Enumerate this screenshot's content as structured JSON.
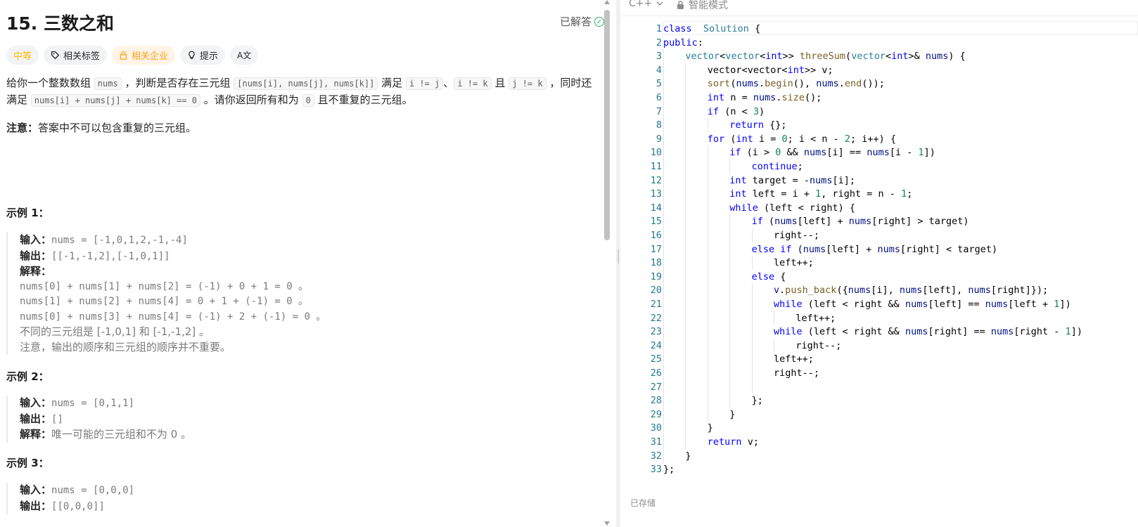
{
  "problem": {
    "title": "15. 三数之和",
    "status_label": "已解答",
    "tags": {
      "difficulty": "中等",
      "related_tags": "相关标签",
      "related_companies": "相关企业",
      "hint": "提示",
      "translate": "A文"
    },
    "desc": {
      "p1_a": "给你一个整数数组",
      "c_nums": "nums",
      "p1_b": "，判断是否存在三元组",
      "c_triple": "[nums[i], nums[j], nums[k]]",
      "p1_c": "满足",
      "c_ij": "i != j",
      "sep1": "、",
      "c_ik": "i != k",
      "p1_d": "且",
      "c_jk": "j != k",
      "p1_e": "，同时还满足",
      "c_sum": "nums[i] + nums[j] + nums[k] == 0",
      "p1_f": "。请你返回所有和为",
      "c_zero": "0",
      "p1_g": "且不重复的三元组。"
    },
    "note_label": "注意：",
    "note_text": "答案中不可以包含重复的三元组。",
    "examples": {
      "e1_title": "示例 1：",
      "e1_input_label": "输入：",
      "e1_input": "nums = [-1,0,1,2,-1,-4]",
      "e1_output_label": "输出：",
      "e1_output": "[[-1,-1,2],[-1,0,1]]",
      "e1_expl_label": "解释：",
      "e1_l1": "nums[0] + nums[1] + nums[2] = (-1) + 0 + 1 = 0 。",
      "e1_l2": "nums[1] + nums[2] + nums[4] = 0 + 1 + (-1) = 0 。",
      "e1_l3": "nums[0] + nums[3] + nums[4] = (-1) + 2 + (-1) = 0 。",
      "e1_l4": "不同的三元组是 [-1,0,1] 和 [-1,-1,2] 。",
      "e1_l5": "注意，输出的顺序和三元组的顺序并不重要。",
      "e2_title": "示例 2：",
      "e2_input_label": "输入：",
      "e2_input": "nums = [0,1,1]",
      "e2_output_label": "输出：",
      "e2_output": "[]",
      "e2_expl_label": "解释：",
      "e2_expl": "唯一可能的三元组和不为 0 。",
      "e3_title": "示例 3：",
      "e3_input_label": "输入：",
      "e3_input": "nums = [0,0,0]",
      "e3_output_label": "输出：",
      "e3_output": "[[0,0,0]]"
    }
  },
  "editor": {
    "language": "C++",
    "mode": "智能模式",
    "saved_label": "已存储",
    "lines": [
      {
        "n": "1",
        "indent": 0,
        "code": [
          [
            "kw",
            "class"
          ],
          [
            "",
            "  "
          ],
          [
            "ty",
            "Solution"
          ],
          [
            "",
            " {"
          ]
        ]
      },
      {
        "n": "2",
        "indent": 0,
        "code": [
          [
            "kw",
            "public"
          ],
          [
            "",
            ":"
          ]
        ]
      },
      {
        "n": "3",
        "indent": 1,
        "code": [
          [
            "ty",
            "vector"
          ],
          [
            "",
            "<"
          ],
          [
            "ty",
            "vector"
          ],
          [
            "",
            "<"
          ],
          [
            "kw",
            "int"
          ],
          [
            "",
            ">> "
          ],
          [
            "fn",
            "threeSum"
          ],
          [
            "",
            "("
          ],
          [
            "ty",
            "vector"
          ],
          [
            "",
            "<"
          ],
          [
            "kw",
            "int"
          ],
          [
            "",
            ">& "
          ],
          [
            "vr",
            "nums"
          ],
          [
            "",
            ") {"
          ]
        ]
      },
      {
        "n": "4",
        "indent": 2,
        "code": [
          [
            "",
            "vector<vector<"
          ],
          [
            "kw",
            "int"
          ],
          [
            "",
            ">> v;"
          ]
        ]
      },
      {
        "n": "5",
        "indent": 2,
        "code": [
          [
            "fn",
            "sort"
          ],
          [
            "",
            "("
          ],
          [
            "vr",
            "nums"
          ],
          [
            "",
            "."
          ],
          [
            "fn",
            "begin"
          ],
          [
            "",
            "(), "
          ],
          [
            "vr",
            "nums"
          ],
          [
            "",
            "."
          ],
          [
            "fn",
            "end"
          ],
          [
            "",
            "());"
          ]
        ]
      },
      {
        "n": "6",
        "indent": 2,
        "code": [
          [
            "kw",
            "int"
          ],
          [
            "",
            " n = "
          ],
          [
            "vr",
            "nums"
          ],
          [
            "",
            "."
          ],
          [
            "fn",
            "size"
          ],
          [
            "",
            "();"
          ]
        ]
      },
      {
        "n": "7",
        "indent": 2,
        "code": [
          [
            "kw",
            "if"
          ],
          [
            "",
            " (n < "
          ],
          [
            "nm",
            "3"
          ],
          [
            "",
            ")"
          ]
        ]
      },
      {
        "n": "8",
        "indent": 3,
        "code": [
          [
            "kw",
            "return"
          ],
          [
            "",
            " {};"
          ]
        ]
      },
      {
        "n": "9",
        "indent": 2,
        "code": [
          [
            "kw",
            "for"
          ],
          [
            "",
            " ("
          ],
          [
            "kw",
            "int"
          ],
          [
            "",
            " i = "
          ],
          [
            "nm",
            "0"
          ],
          [
            "",
            "; i < n - "
          ],
          [
            "nm",
            "2"
          ],
          [
            "",
            "; i++) {"
          ]
        ]
      },
      {
        "n": "10",
        "indent": 3,
        "code": [
          [
            "kw",
            "if"
          ],
          [
            "",
            " (i > "
          ],
          [
            "nm",
            "0"
          ],
          [
            "",
            " && "
          ],
          [
            "vr",
            "nums"
          ],
          [
            "",
            "[i] == "
          ],
          [
            "vr",
            "nums"
          ],
          [
            "",
            "[i - "
          ],
          [
            "nm",
            "1"
          ],
          [
            "",
            "])"
          ]
        ]
      },
      {
        "n": "11",
        "indent": 4,
        "code": [
          [
            "kw",
            "continue"
          ],
          [
            "",
            ";"
          ]
        ]
      },
      {
        "n": "12",
        "indent": 3,
        "code": [
          [
            "kw",
            "int"
          ],
          [
            "",
            " target = -"
          ],
          [
            "vr",
            "nums"
          ],
          [
            "",
            "[i];"
          ]
        ]
      },
      {
        "n": "13",
        "indent": 3,
        "code": [
          [
            "kw",
            "int"
          ],
          [
            "",
            " left = i + "
          ],
          [
            "nm",
            "1"
          ],
          [
            "",
            ", right = n - "
          ],
          [
            "nm",
            "1"
          ],
          [
            "",
            ";"
          ]
        ]
      },
      {
        "n": "14",
        "indent": 3,
        "code": [
          [
            "kw",
            "while"
          ],
          [
            "",
            " (left < right) {"
          ]
        ]
      },
      {
        "n": "15",
        "indent": 4,
        "code": [
          [
            "kw",
            "if"
          ],
          [
            "",
            " ("
          ],
          [
            "vr",
            "nums"
          ],
          [
            "",
            "[left] + "
          ],
          [
            "vr",
            "nums"
          ],
          [
            "",
            "[right] > target)"
          ]
        ]
      },
      {
        "n": "16",
        "indent": 5,
        "code": [
          [
            "",
            "right--;"
          ]
        ]
      },
      {
        "n": "17",
        "indent": 4,
        "code": [
          [
            "kw",
            "else"
          ],
          [
            "",
            " "
          ],
          [
            "kw",
            "if"
          ],
          [
            "",
            " ("
          ],
          [
            "vr",
            "nums"
          ],
          [
            "",
            "[left] + "
          ],
          [
            "vr",
            "nums"
          ],
          [
            "",
            "[right] < target)"
          ]
        ]
      },
      {
        "n": "18",
        "indent": 5,
        "code": [
          [
            "",
            "left++;"
          ]
        ]
      },
      {
        "n": "19",
        "indent": 4,
        "code": [
          [
            "kw",
            "else"
          ],
          [
            "",
            " {"
          ]
        ]
      },
      {
        "n": "20",
        "indent": 5,
        "code": [
          [
            "vr",
            "v"
          ],
          [
            "",
            "."
          ],
          [
            "fn",
            "push_back"
          ],
          [
            "",
            "({"
          ],
          [
            "vr",
            "nums"
          ],
          [
            "",
            "[i], "
          ],
          [
            "vr",
            "nums"
          ],
          [
            "",
            "[left], "
          ],
          [
            "vr",
            "nums"
          ],
          [
            "",
            "[right]});"
          ]
        ]
      },
      {
        "n": "21",
        "indent": 5,
        "code": [
          [
            "kw",
            "while"
          ],
          [
            "",
            " (left < right && "
          ],
          [
            "vr",
            "nums"
          ],
          [
            "",
            "[left] == "
          ],
          [
            "vr",
            "nums"
          ],
          [
            "",
            "[left + "
          ],
          [
            "nm",
            "1"
          ],
          [
            "",
            "])"
          ]
        ]
      },
      {
        "n": "22",
        "indent": 6,
        "code": [
          [
            "",
            "left++;"
          ]
        ]
      },
      {
        "n": "23",
        "indent": 5,
        "code": [
          [
            "kw",
            "while"
          ],
          [
            "",
            " (left < right && "
          ],
          [
            "vr",
            "nums"
          ],
          [
            "",
            "[right] == "
          ],
          [
            "vr",
            "nums"
          ],
          [
            "",
            "[right - "
          ],
          [
            "nm",
            "1"
          ],
          [
            "",
            "])"
          ]
        ]
      },
      {
        "n": "24",
        "indent": 6,
        "code": [
          [
            "",
            "right--;"
          ]
        ]
      },
      {
        "n": "25",
        "indent": 5,
        "code": [
          [
            "",
            "left++;"
          ]
        ]
      },
      {
        "n": "26",
        "indent": 5,
        "code": [
          [
            "",
            "right--;"
          ]
        ]
      },
      {
        "n": "27",
        "indent": 5,
        "code": []
      },
      {
        "n": "28",
        "indent": 4,
        "code": [
          [
            "",
            "};"
          ]
        ]
      },
      {
        "n": "29",
        "indent": 3,
        "code": [
          [
            "",
            "}"
          ]
        ]
      },
      {
        "n": "30",
        "indent": 2,
        "code": [
          [
            "",
            "}"
          ]
        ]
      },
      {
        "n": "31",
        "indent": 2,
        "code": [
          [
            "kw",
            "return"
          ],
          [
            "",
            " v;"
          ]
        ]
      },
      {
        "n": "32",
        "indent": 1,
        "code": [
          [
            "",
            "}"
          ]
        ]
      },
      {
        "n": "33",
        "indent": 0,
        "code": [
          [
            "",
            "};"
          ]
        ]
      }
    ]
  }
}
